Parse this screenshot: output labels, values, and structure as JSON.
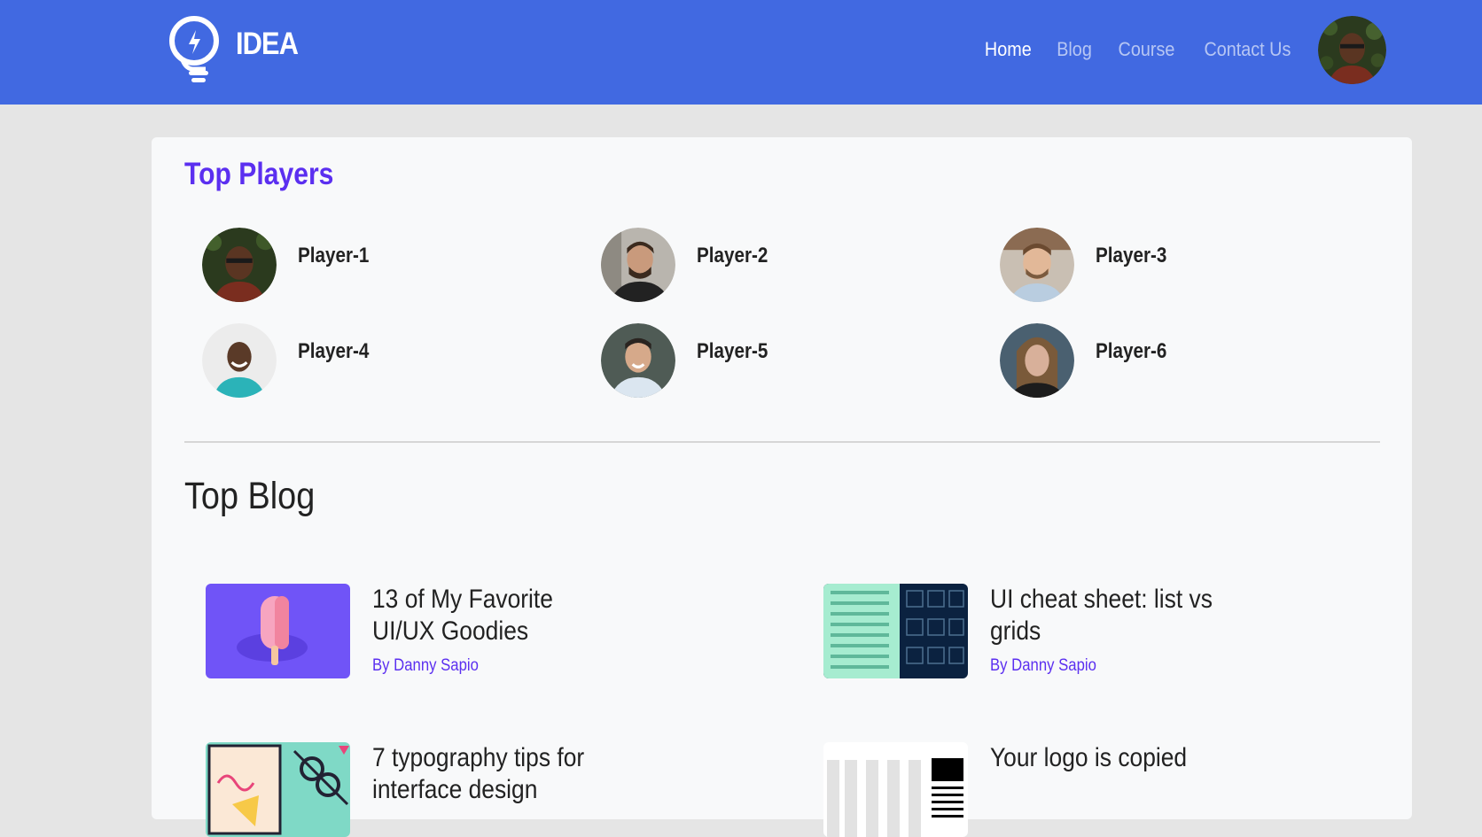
{
  "navbar": {
    "brand": "IDEA",
    "links": [
      {
        "label": "Home",
        "active": true
      },
      {
        "label": "Blog",
        "active": false
      },
      {
        "label": "Course",
        "active": false
      },
      {
        "label": "Contact Us",
        "active": false
      }
    ],
    "bg_color": "#4169e1"
  },
  "players": {
    "title": "Top Players",
    "title_color": "#5b2ff0",
    "items": [
      {
        "name": "Player-1"
      },
      {
        "name": "Player-2"
      },
      {
        "name": "Player-3"
      },
      {
        "name": "Player-4"
      },
      {
        "name": "Player-5"
      },
      {
        "name": "Player-6"
      }
    ]
  },
  "blog": {
    "title": "Top Blog",
    "items": [
      {
        "title": "13 of My Favorite UI/UX Goodies",
        "author": "By Danny Sapio"
      },
      {
        "title": "UI cheat sheet: list vs grids",
        "author": "By Danny Sapio"
      },
      {
        "title": "7 typography tips for interface design",
        "author": ""
      },
      {
        "title": "Your logo is copied",
        "author": ""
      }
    ]
  },
  "icons": [
    "lightbulb-logo-icon",
    "avatar"
  ]
}
